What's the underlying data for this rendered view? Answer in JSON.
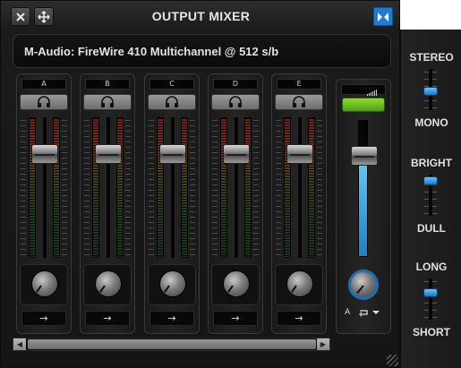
{
  "window": {
    "title": "OUTPUT MIXER",
    "close_icon": "close-x-icon",
    "move_icon": "move-arrows-icon",
    "dock_icon": "dock-toggle-icon"
  },
  "device": {
    "name": "M-Audio: FireWire 410 Multichannel @ 512 s/b"
  },
  "channels": [
    {
      "label": "A",
      "route": "→",
      "fader_level": 0.78
    },
    {
      "label": "B",
      "route": "→",
      "fader_level": 0.78
    },
    {
      "label": "C",
      "route": "→",
      "fader_level": 0.78
    },
    {
      "label": "D",
      "route": "→",
      "fader_level": 0.78
    },
    {
      "label": "E",
      "route": "→",
      "fader_level": 0.78
    }
  ],
  "master": {
    "fader_level": 0.78,
    "level_fill": 0.78,
    "output_select": "A",
    "output_icon": "loop-arrow-icon",
    "accent": "#1c7dd1",
    "green": "#6cc02a"
  },
  "side_controls": [
    {
      "top": "STEREO",
      "bottom": "MONO",
      "value": 0.55
    },
    {
      "top": "BRIGHT",
      "bottom": "DULL",
      "value": 0.05
    },
    {
      "top": "LONG",
      "bottom": "SHORT",
      "value": 0.3
    }
  ]
}
